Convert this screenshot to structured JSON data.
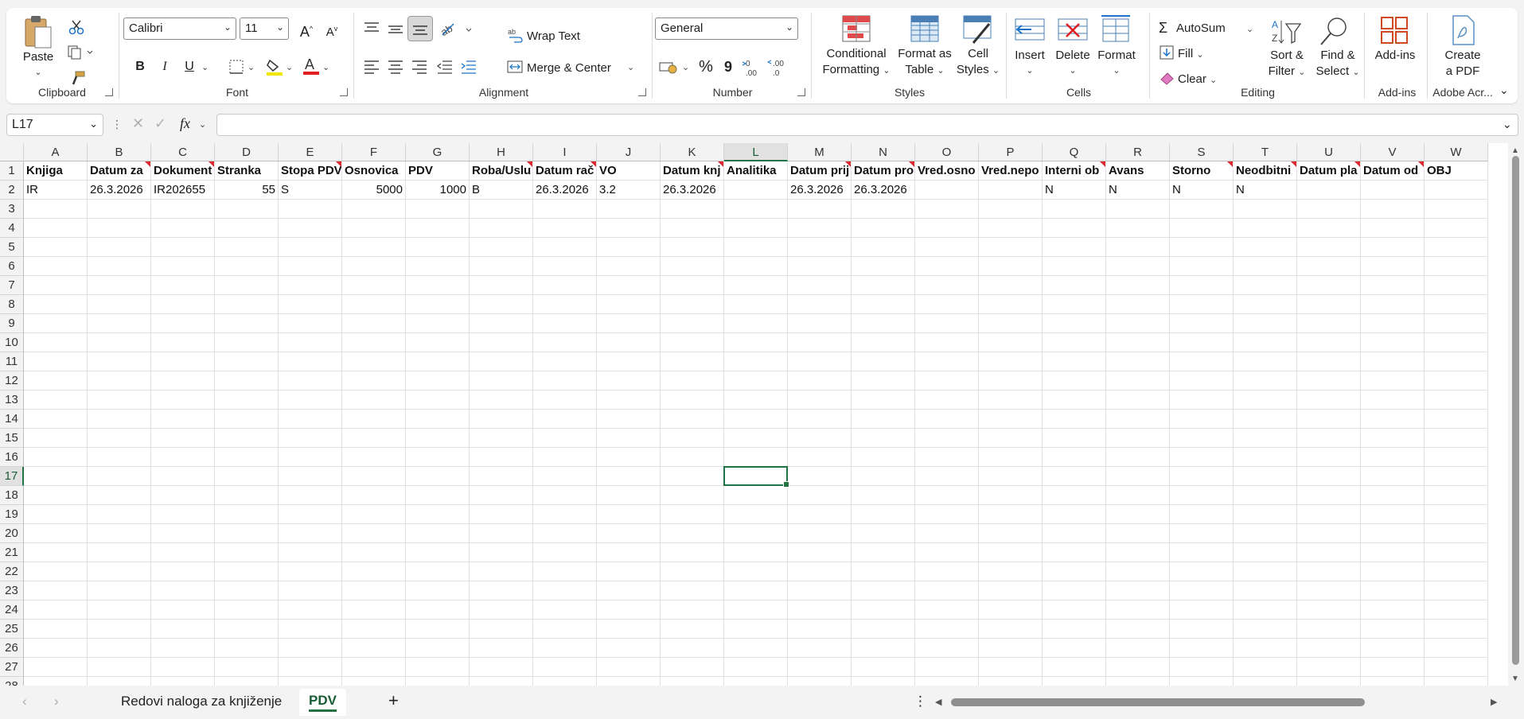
{
  "ribbon": {
    "clipboard": {
      "label": "Clipboard",
      "paste": "Paste"
    },
    "font": {
      "label": "Font",
      "name": "Calibri",
      "size": "11",
      "bold": "B",
      "italic": "I",
      "underline": "U"
    },
    "alignment": {
      "label": "Alignment",
      "wrap": "Wrap Text",
      "merge": "Merge & Center"
    },
    "number": {
      "label": "Number",
      "format": "General",
      "percent": "%",
      "comma": "9"
    },
    "styles": {
      "label": "Styles",
      "conditional1": "Conditional",
      "conditional2": "Formatting",
      "table1": "Format as",
      "table2": "Table",
      "cell1": "Cell",
      "cell2": "Styles"
    },
    "cells": {
      "label": "Cells",
      "insert": "Insert",
      "delete": "Delete",
      "format": "Format"
    },
    "editing": {
      "label": "Editing",
      "autosum": "AutoSum",
      "fill": "Fill",
      "clear": "Clear",
      "sort1": "Sort &",
      "sort2": "Filter",
      "find1": "Find &",
      "find2": "Select"
    },
    "addins": {
      "label": "Add-ins",
      "button": "Add-ins"
    },
    "adobe": {
      "label": "Adobe Acr...",
      "create1": "Create",
      "create2": "a PDF"
    }
  },
  "formula_bar": {
    "name_box": "L17",
    "fx": "fx",
    "value": ""
  },
  "grid": {
    "columns": [
      "A",
      "B",
      "C",
      "D",
      "E",
      "F",
      "G",
      "H",
      "I",
      "J",
      "K",
      "L",
      "M",
      "N",
      "O",
      "P",
      "Q",
      "R",
      "S",
      "T",
      "U",
      "V",
      "W"
    ],
    "selected_column": "L",
    "selected_row": 17,
    "rows": [
      {
        "n": 1,
        "cells": [
          "Knjiga",
          "Datum za",
          "Dokument",
          "Stranka",
          "Stopa PDV",
          "Osnovica",
          "PDV",
          "Roba/Uslu",
          "Datum rač",
          "VO",
          "Datum knj",
          "Analitika",
          "Datum prij",
          "Datum pro",
          "Vred.osno",
          "Vred.nepo",
          "Interni ob",
          "Avans",
          "Storno",
          "Neodbitni",
          "Datum pla",
          "Datum od",
          "OBJ"
        ]
      },
      {
        "n": 2,
        "cells": [
          "IR",
          "26.3.2026",
          "IR202655",
          "55",
          "S",
          "5000",
          "1000",
          "B",
          "26.3.2026",
          "3.2",
          "26.3.2026",
          "",
          "26.3.2026",
          "26.3.2026",
          "",
          "",
          "N",
          "N",
          "N",
          "N",
          "",
          "",
          ""
        ]
      }
    ]
  },
  "sheets": [
    {
      "name": "Redovi naloga za knjiženje",
      "active": false
    },
    {
      "name": "PDV",
      "active": true
    }
  ],
  "colors": {
    "accent": "#217346",
    "comment": "#e0262f"
  }
}
